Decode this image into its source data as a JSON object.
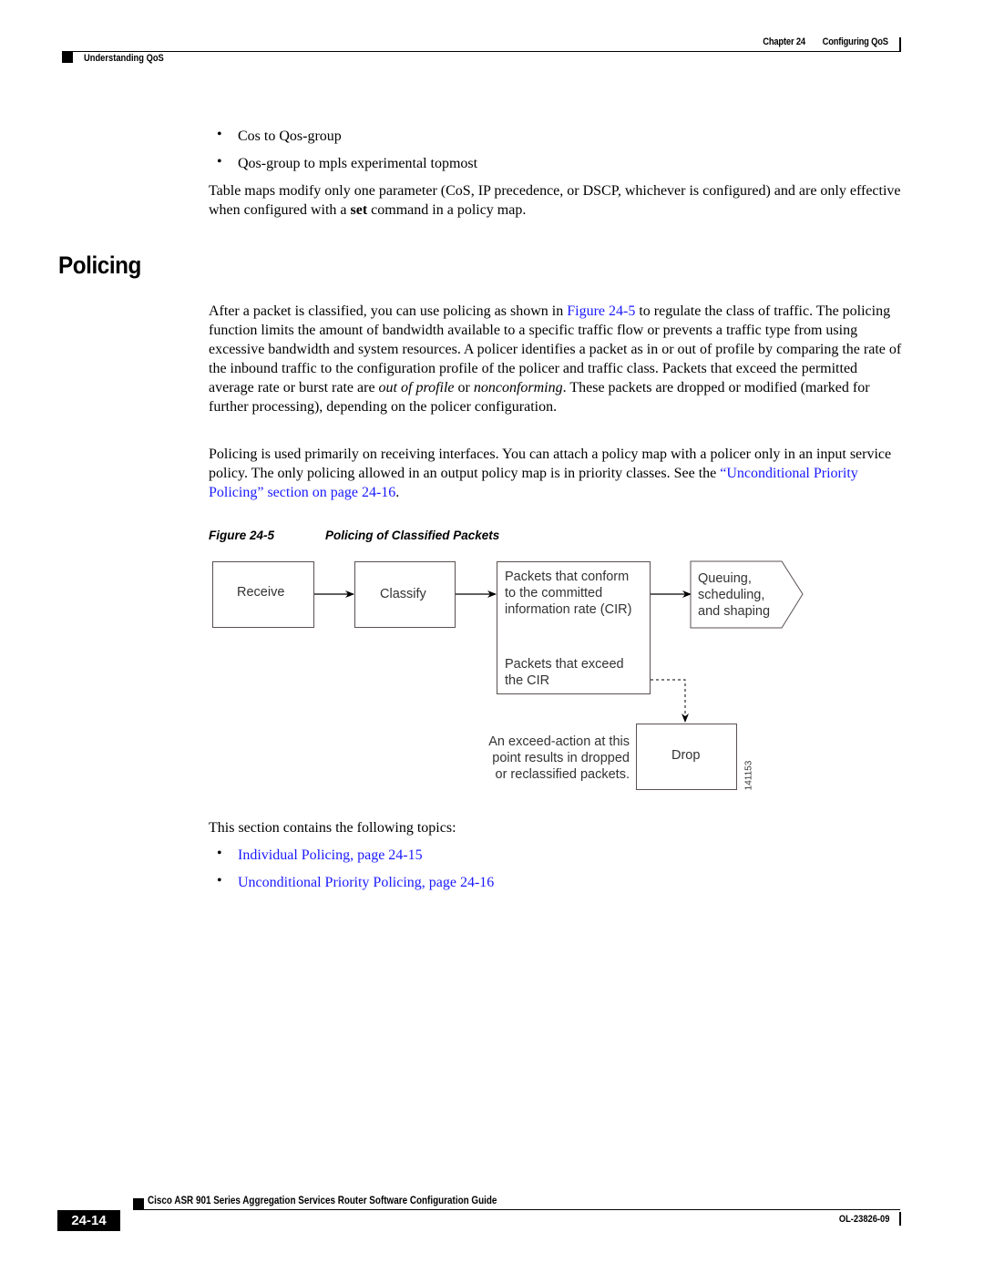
{
  "header": {
    "chapter_label": "Chapter 24",
    "chapter_title": "Configuring QoS",
    "section": "Understanding QoS"
  },
  "intro": {
    "bullets": [
      "Cos to Qos-group",
      "Qos-group to mpls experimental topmost"
    ],
    "table_maps_para": {
      "before": "Table maps modify only one parameter (CoS, IP precedence, or DSCP, whichever is configured) and are only effective when configured with a ",
      "bold": "set",
      "after": " command in a policy map."
    }
  },
  "section": {
    "title": "Policing",
    "para1": {
      "before": "After a packet is classified, you can use policing as shown in ",
      "link": "Figure 24-5",
      "middle": " to regulate the class of traffic. The policing function limits the amount of bandwidth available to a specific traffic flow or prevents a traffic type from using excessive bandwidth and system resources. A policer identifies a packet as in or out of profile by comparing the rate of the inbound traffic to the configuration profile of the policer and traffic class. Packets that exceed the permitted average rate or burst rate are ",
      "italic1": "out of profile",
      "middle2": " or ",
      "italic2": "nonconforming",
      "after": ". These packets are dropped or modified (marked for further processing), depending on the policer configuration."
    },
    "para2": {
      "before": "Policing is used primarily on receiving interfaces. You can attach a policy map with a policer only in an input service policy. The only policing allowed in an output policy map is in priority classes. See the ",
      "link": "“Unconditional Priority Policing” section on page 24-16",
      "after": "."
    },
    "figure": {
      "number": "Figure 24-5",
      "caption": "Policing of Classified Packets",
      "nodes": {
        "receive": "Receive",
        "classify": "Classify",
        "conform": [
          "Packets that conform",
          "to the committed",
          "information rate (CIR)"
        ],
        "exceed": [
          "Packets that exceed",
          "the CIR"
        ],
        "queuing": [
          "Queuing,",
          "scheduling,",
          "and shaping"
        ],
        "drop": "Drop",
        "note": [
          "An exceed-action at this",
          "point results in dropped",
          "or reclassified packets."
        ],
        "figure_id": "141153"
      }
    },
    "topics_intro": "This section contains the following topics:",
    "topics": [
      "Individual Policing, page 24-15",
      "Unconditional Priority Policing, page 24-16"
    ]
  },
  "footer": {
    "guide_title": "Cisco ASR 901 Series Aggregation Services Router Software Configuration Guide",
    "page_number": "24-14",
    "doc_number": "OL-23826-09"
  },
  "colors": {
    "link": "#1a1aff",
    "text": "#000000",
    "diagram_text": "#333333"
  }
}
